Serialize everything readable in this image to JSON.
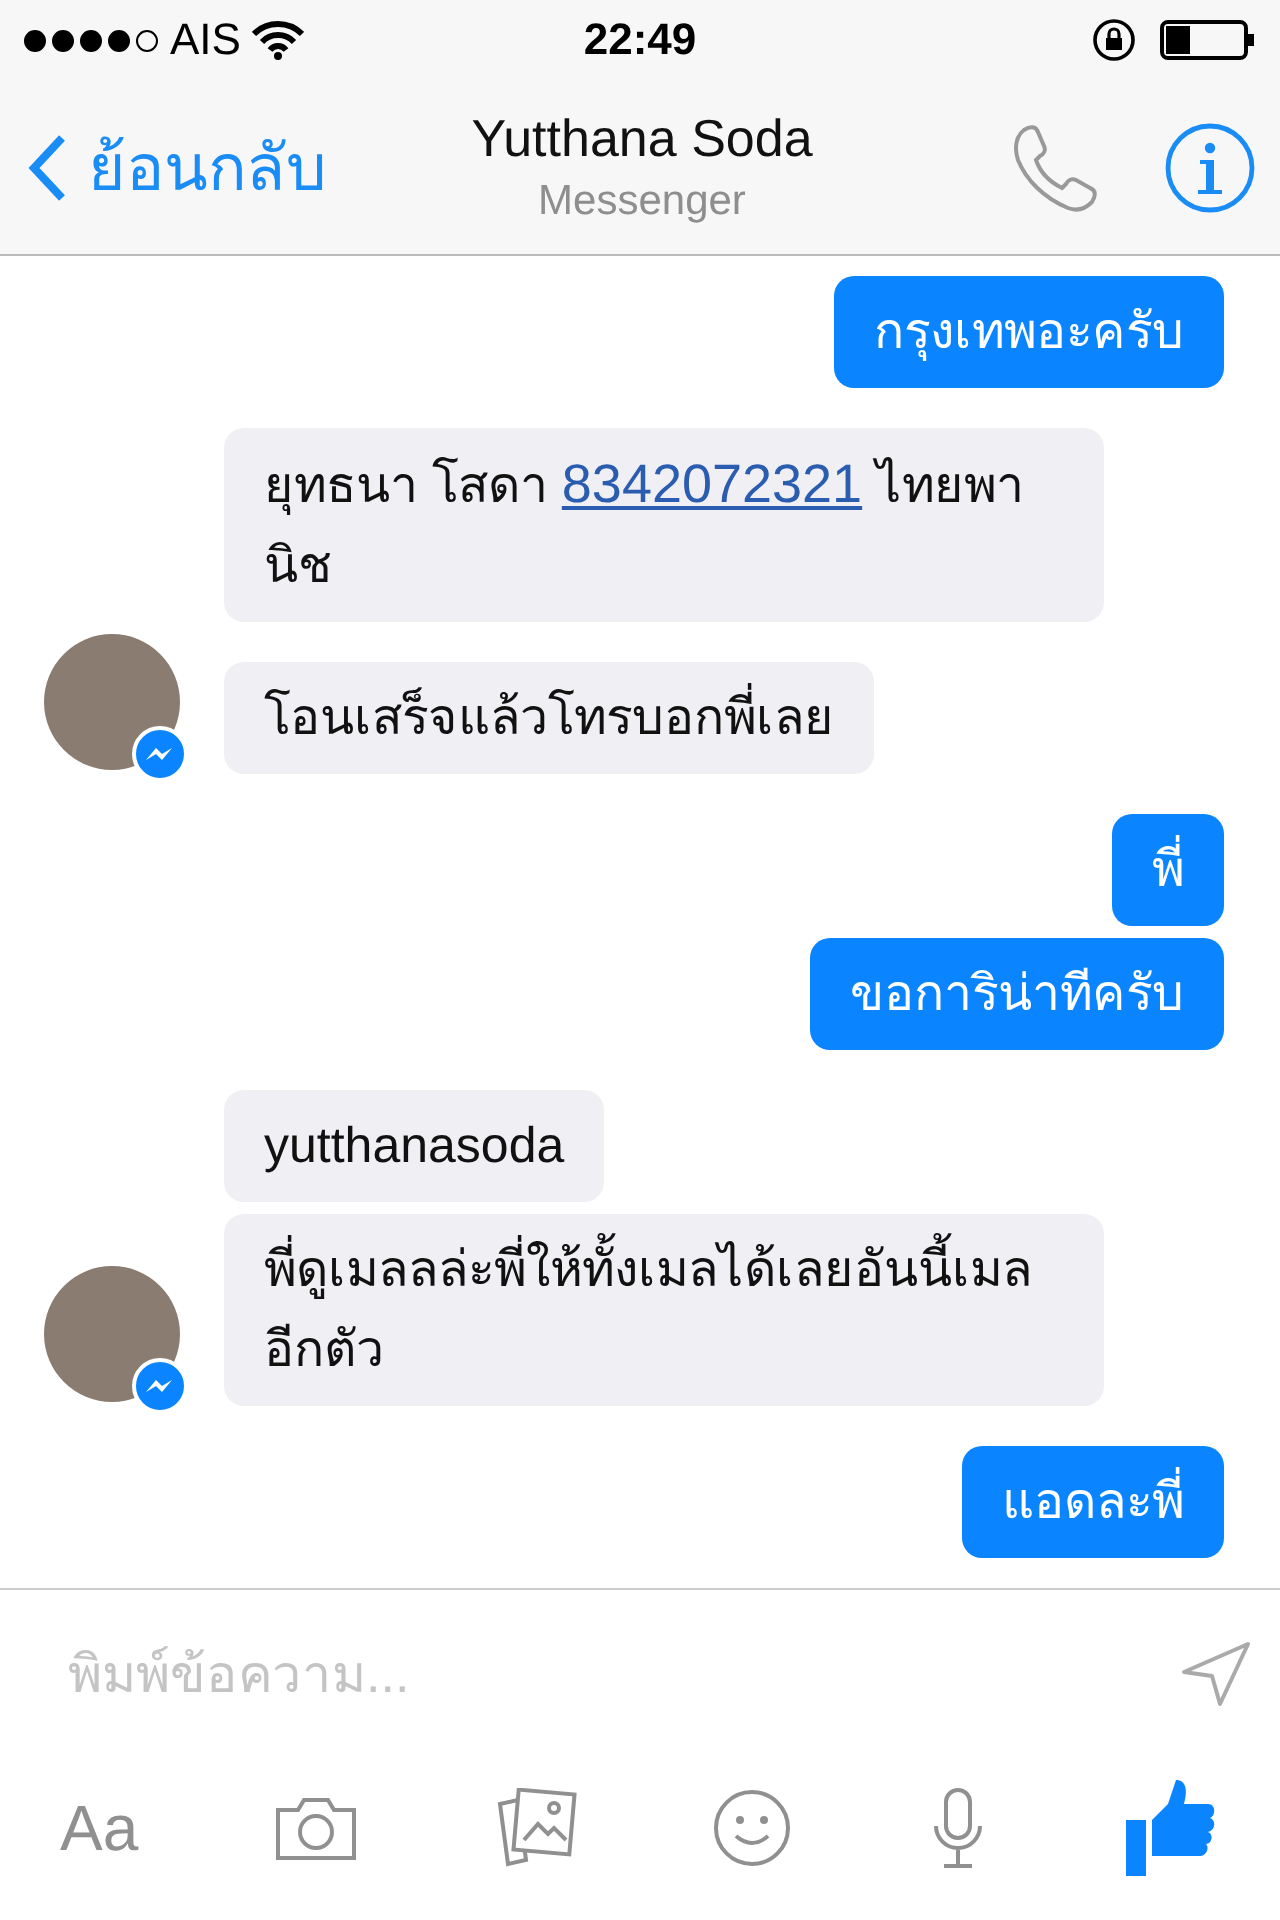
{
  "status_bar": {
    "carrier": "AIS",
    "time": "22:49"
  },
  "nav": {
    "back": "ย้อนกลับ",
    "title": "Yutthana Soda",
    "subtitle": "Messenger"
  },
  "messages": [
    {
      "kind": "outgoing",
      "avatar": false,
      "parts": [
        {
          "kind": "text",
          "text": "กรุงเทพอะครับ"
        }
      ]
    },
    {
      "kind": "incoming",
      "avatar": false,
      "parts": [
        {
          "kind": "text",
          "text": "ยุทธนา โสดา "
        },
        {
          "kind": "link",
          "text": "8342072321"
        },
        {
          "kind": "text",
          "text": " ไทยพานิช"
        }
      ]
    },
    {
      "kind": "incoming",
      "avatar": true,
      "parts": [
        {
          "kind": "text",
          "text": "โอนเสร็จแล้วโทรบอกพี่เลย"
        }
      ]
    },
    {
      "kind": "outgoing",
      "avatar": false,
      "parts": [
        {
          "kind": "text",
          "text": "พี่"
        }
      ]
    },
    {
      "kind": "outgoing",
      "avatar": false,
      "parts": [
        {
          "kind": "text",
          "text": "ขอการิน่าทีครับ"
        }
      ]
    },
    {
      "kind": "incoming",
      "avatar": false,
      "parts": [
        {
          "kind": "text",
          "text": "yutthanasoda"
        }
      ]
    },
    {
      "kind": "incoming",
      "avatar": true,
      "parts": [
        {
          "kind": "text",
          "text": "พี่ดูเมลลล่ะพี่ให้ทั้งเมลได้เลยอันนี้เมลอีกตัว"
        }
      ]
    },
    {
      "kind": "outgoing",
      "avatar": false,
      "parts": [
        {
          "kind": "text",
          "text": "แอดละพี่"
        }
      ]
    }
  ],
  "composer": {
    "placeholder": "พิมพ์ข้อความ...",
    "font_button": "Aa"
  }
}
